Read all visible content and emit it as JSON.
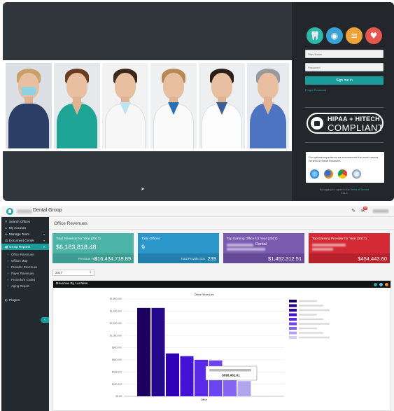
{
  "login": {
    "username_placeholder": "User Name",
    "password_placeholder": "Password",
    "sign_in_label": "Sign me in",
    "forgot_label": "Forgot Password",
    "hipaa_line1": "HIPAA + HITECH",
    "hipaa_line2": "COMPLIANT",
    "browser_message": "For optimal experience we recommend the most current version of these browsers.",
    "legal_prefix": "By logging in I agree to the",
    "legal_link": "Terms of Service",
    "legal_suffix": "EULA",
    "badge_icons": [
      "tooth-icon",
      "eye-icon",
      "spine-icon",
      "heartbeat-icon"
    ],
    "badge_colors": [
      "#2eb8ac",
      "#3aa3d6",
      "#f0a33a",
      "#e8574e"
    ],
    "browser_icons": [
      "internet-explorer-icon",
      "firefox-icon",
      "chrome-icon",
      "safari-icon"
    ]
  },
  "header": {
    "app_title": "Dental Group",
    "notification_count": "99"
  },
  "sidebar": {
    "items": [
      {
        "icon": "search-icon",
        "glyph": "⚲",
        "label": "Search Offices"
      },
      {
        "icon": "home-icon",
        "glyph": "⌂",
        "label": "My Account"
      },
      {
        "icon": "team-icon",
        "glyph": "✣",
        "label": "Manage Team"
      },
      {
        "icon": "document-icon",
        "glyph": "▤",
        "label": "Document Center"
      },
      {
        "icon": "chart-icon",
        "glyph": "▦",
        "label": "Group Reports"
      }
    ],
    "sub_items": [
      "Office Revenues",
      "Offices Map",
      "Provider Revenues",
      "Payer Revenues",
      "Procedure Codes",
      "Aging Report"
    ],
    "plugins_label": "Plugins"
  },
  "page": {
    "title": "Office Revenues",
    "year_value": "2017"
  },
  "kpis": [
    {
      "label": "Total Revenue for Year (2017)",
      "value": "$6,183,818.48",
      "foot_label": "Previous Year",
      "foot_value": "$16,434,718.89",
      "color": "#4bb3a8",
      "foot_color": "#3e9c92"
    },
    {
      "label": "Total Offices",
      "value": "9",
      "foot_label": "Total Provider IDs",
      "foot_value": "239",
      "color": "#2a96c9",
      "foot_color": "#227fac"
    },
    {
      "label": "Top Earning Office for Year (2017)",
      "value": "Dental",
      "foot_label": "",
      "foot_value": "$1,452,312.51",
      "color": "#7a5bb0",
      "foot_color": "#654896"
    },
    {
      "label": "Top Earning Provider for Year (2017)",
      "value": "",
      "foot_label": "",
      "foot_value": "$454,443.60",
      "color": "#d32a36",
      "foot_color": "#b7212c"
    }
  ],
  "panel": {
    "title": "Revenue By Location",
    "dot_colors": [
      "#2aa7a3",
      "#4fc3e8",
      "#f08a24"
    ]
  },
  "chart_data": {
    "type": "bar",
    "title": "Office Revenues",
    "xlabel": "Office",
    "ylabel": "",
    "ylim": [
      0,
      1600000
    ],
    "yticks": [
      "$0.00",
      "$200,000",
      "$400,000",
      "$600,000",
      "$800,000",
      "$1,000,000",
      "$1,200,000",
      "$1,400,000",
      "$1,600,000"
    ],
    "values": [
      1452312,
      1452312,
      705000,
      660000,
      600000,
      590000,
      490000,
      250000,
      8000
    ],
    "colors": [
      "#1b005f",
      "#240a8a",
      "#3000b8",
      "#4412d6",
      "#5a2ae8",
      "#6d45f0",
      "#8664f2",
      "#b3a4ee",
      "#d6d0f2"
    ],
    "tooltip_value": "$595,982.61"
  }
}
